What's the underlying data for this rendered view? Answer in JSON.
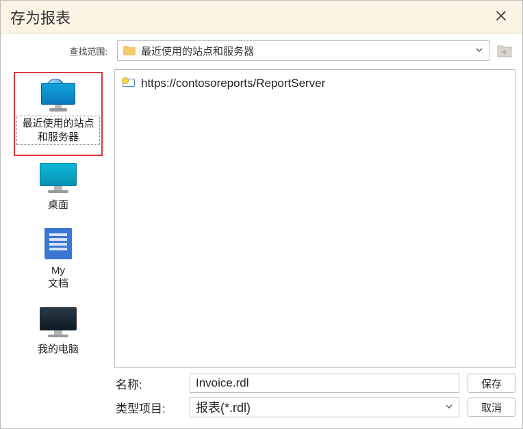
{
  "dialog": {
    "title": "存为报表"
  },
  "lookin": {
    "label": "查找范围:",
    "selected": "最近使用的站点和服务器"
  },
  "places": {
    "recent": "最近使用的站点和服务器",
    "desktop": "桌面",
    "mydocs_line1": "My",
    "mydocs_line2": "文档",
    "mycomputer": "我的电脑"
  },
  "files": {
    "item0": "https://contosoreports/ReportServer"
  },
  "form": {
    "name_label": "名称:",
    "name_value": "Invoice.rdl",
    "type_label": "类型项目:",
    "type_value": "报表(*.rdl)"
  },
  "buttons": {
    "save": "保存",
    "cancel": "取消"
  }
}
